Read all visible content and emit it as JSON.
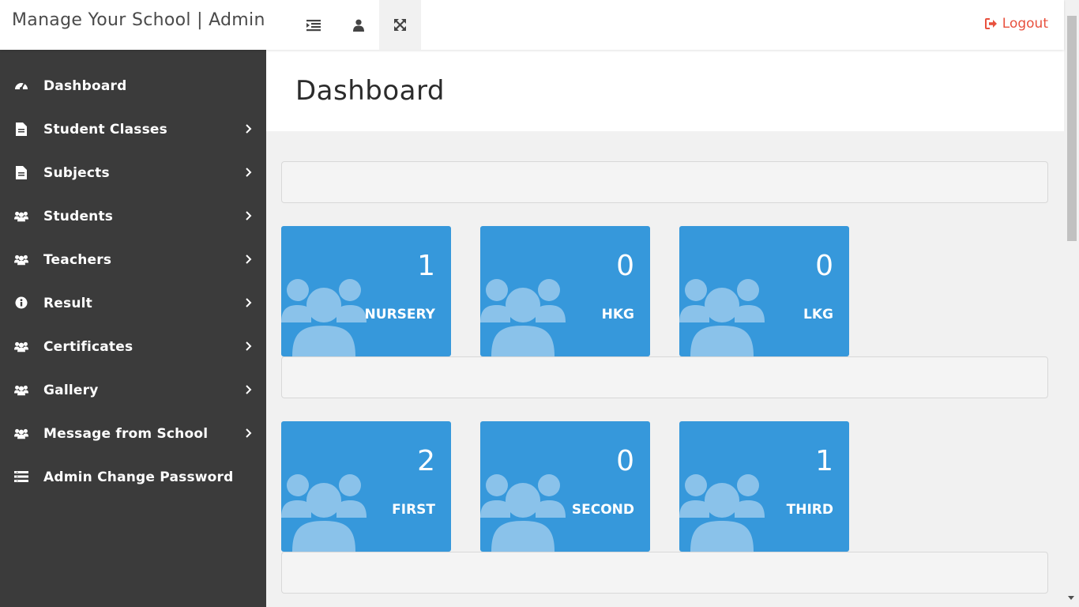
{
  "header": {
    "brand": "Manage Your School | Admin",
    "logout_label": "Logout",
    "icons": [
      "menu-indent-icon",
      "user-icon",
      "expand-icon",
      "logout-icon"
    ]
  },
  "sidebar": {
    "items": [
      {
        "label": "Dashboard",
        "icon": "dashboard-icon",
        "has_children": false
      },
      {
        "label": "Student Classes",
        "icon": "file-icon",
        "has_children": true
      },
      {
        "label": "Subjects",
        "icon": "file-icon",
        "has_children": true
      },
      {
        "label": "Students",
        "icon": "users-icon",
        "has_children": true
      },
      {
        "label": "Teachers",
        "icon": "users-icon",
        "has_children": true
      },
      {
        "label": "Result",
        "icon": "info-icon",
        "has_children": true
      },
      {
        "label": "Certificates",
        "icon": "users-icon",
        "has_children": true
      },
      {
        "label": "Gallery",
        "icon": "users-icon",
        "has_children": true
      },
      {
        "label": "Message from School",
        "icon": "users-icon",
        "has_children": true
      },
      {
        "label": "Admin Change Password",
        "icon": "list-icon",
        "has_children": false
      }
    ]
  },
  "page": {
    "title": "Dashboard"
  },
  "cards": [
    {
      "count": "1",
      "label": "NURSERY"
    },
    {
      "count": "0",
      "label": "HKG"
    },
    {
      "count": "0",
      "label": "LKG"
    },
    {
      "count": "2",
      "label": "FIRST"
    },
    {
      "count": "0",
      "label": "SECOND"
    },
    {
      "count": "1",
      "label": "THIRD"
    }
  ],
  "colors": {
    "card_bg": "#3698db",
    "sidebar_bg": "#3b3b3b",
    "logout": "#e8513e",
    "people_icon": "#8ac2ea"
  }
}
